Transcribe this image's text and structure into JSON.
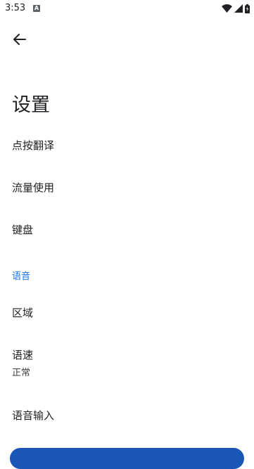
{
  "status_bar": {
    "time": "3:53",
    "notification_icon": "A"
  },
  "header": {
    "back_icon": "arrow-back-icon",
    "title": "设置"
  },
  "items": [
    {
      "label": "点按翻译"
    },
    {
      "label": "流量使用"
    },
    {
      "label": "键盘"
    }
  ],
  "section": {
    "title": "语音"
  },
  "voice_items": [
    {
      "label": "区域"
    },
    {
      "label": "语速",
      "sublabel": "正常"
    },
    {
      "label": "语音输入"
    }
  ],
  "colors": {
    "accent": "#1a73e8",
    "button": "#1a56b8"
  }
}
